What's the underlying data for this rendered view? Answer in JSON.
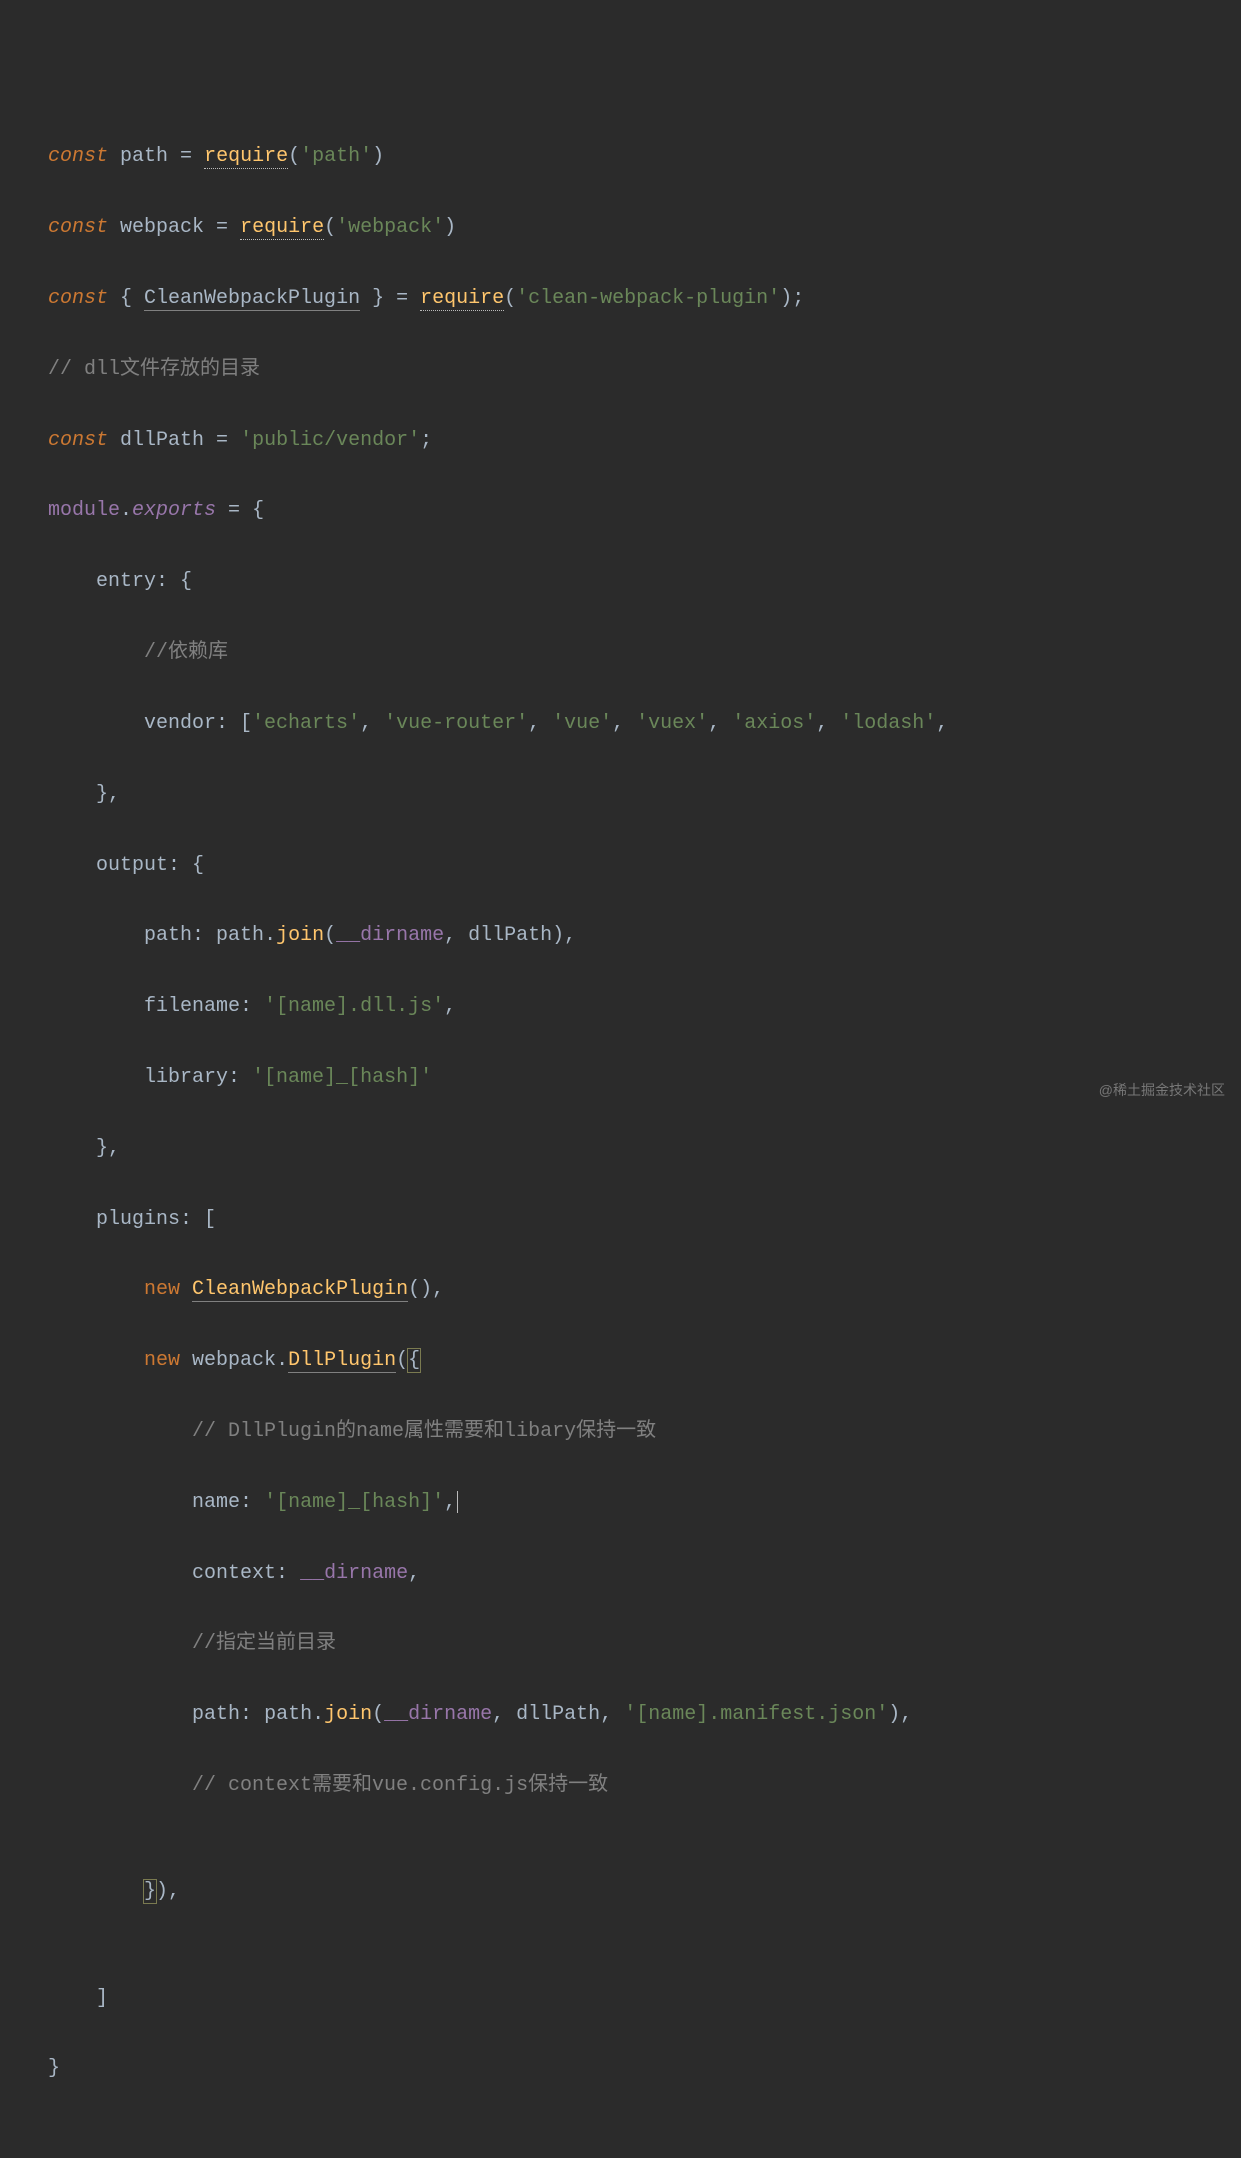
{
  "watermark": "@稀土掘金技术社区",
  "gutter": {
    "visible_chars": [
      "",
      "",
      "",
      "",
      "",
      "",
      "",
      "",
      "",
      "",
      "",
      "",
      "",
      "",
      "",
      "",
      "",
      "",
      "",
      "",
      "",
      "",
      "",
      "",
      "",
      "",
      "",
      "",
      "",
      "",
      ""
    ]
  },
  "code": {
    "l1": {
      "const": "const",
      "name": "path",
      "eq": " = ",
      "req": "require",
      "paren_o": "(",
      "arg": "'path'",
      "paren_c": ")"
    },
    "l2": {
      "const": "const",
      "name": "webpack",
      "eq": " = ",
      "req": "require",
      "paren_o": "(",
      "arg": "'webpack'",
      "paren_c": ")"
    },
    "l3": {
      "const": "const",
      "brace_o": " { ",
      "name": "CleanWebpackPlugin",
      "brace_c": " } ",
      "eq": "= ",
      "req": "require",
      "paren_o": "(",
      "arg": "'clean-webpack-plugin'",
      "paren_c": ");"
    },
    "l4": {
      "cmt": "// dll文件存放的目录"
    },
    "l5": {
      "const": "const",
      "name": "dllPath",
      "eq": " = ",
      "val": "'public/vendor'",
      "semi": ";"
    },
    "l6": {
      "mod": "module",
      "dot": ".",
      "exp": "exports",
      "eq": " = ",
      "brace": "{"
    },
    "l7": {
      "key": "entry",
      "colon": ": ",
      "brace": "{"
    },
    "l8": {
      "cmt": "//依赖库"
    },
    "l9": {
      "key": "vendor",
      "colon": ": [",
      "a": "'echarts'",
      "c1": ", ",
      "b": "'vue-router'",
      "c2": ", ",
      "c": "'vue'",
      "c3": ", ",
      "d": "'vuex'",
      "c4": ", ",
      "e": "'axios'",
      "c5": ", ",
      "f": "'lodash'",
      "c6": ", "
    },
    "l10": {
      "brace": "},"
    },
    "l11": {
      "key": "output",
      "colon": ": ",
      "brace": "{"
    },
    "l12": {
      "key": "path",
      "colon": ": ",
      "obj": "path",
      "dot": ".",
      "fn": "join",
      "paren_o": "(",
      "a": "__dirname",
      "c1": ", ",
      "b": "dllPath",
      "paren_c": "),"
    },
    "l13": {
      "key": "filename",
      "colon": ": ",
      "val": "'[name].dll.js'",
      "comma": ","
    },
    "l14": {
      "key": "library",
      "colon": ": ",
      "val": "'[name]_[hash]'"
    },
    "l15": {
      "brace": "},"
    },
    "l16": {
      "key": "plugins",
      "colon": ": [",
      "": ""
    },
    "l17": {
      "new": "new",
      "sp": " ",
      "cls": "CleanWebpackPlugin",
      "call": "(),"
    },
    "l18": {
      "new": "new",
      "sp": " ",
      "obj": "webpack",
      "dot": ".",
      "cls": "DllPlugin",
      "paren_o": "(",
      "brace": "{"
    },
    "l19": {
      "cmt": "// DllPlugin的name属性需要和libary保持一致"
    },
    "l20": {
      "key": "name",
      "colon": ": ",
      "val": "'[name]_[hash]'",
      "comma": ","
    },
    "l21": {
      "key": "context",
      "colon": ": ",
      "val": "__dirname",
      "comma": ","
    },
    "l22": {
      "cmt": "//指定当前目录"
    },
    "l23": {
      "key": "path",
      "colon": ": ",
      "obj": "path",
      "dot": ".",
      "fn": "join",
      "paren_o": "(",
      "a": "__dirname",
      "c1": ", ",
      "b": "dllPath",
      "c2": ", ",
      "c": "'[name].manifest.json'",
      "paren_c": "),"
    },
    "l24": {
      "cmt": "// context需要和vue.config.js保持一致"
    },
    "l25": {
      "blank": ""
    },
    "l26": {
      "brace_c": "}",
      "paren_c": "),"
    },
    "l27": {
      "blank": ""
    },
    "l28": {
      "bracket": "]"
    },
    "l29": {
      "brace": "}"
    }
  }
}
